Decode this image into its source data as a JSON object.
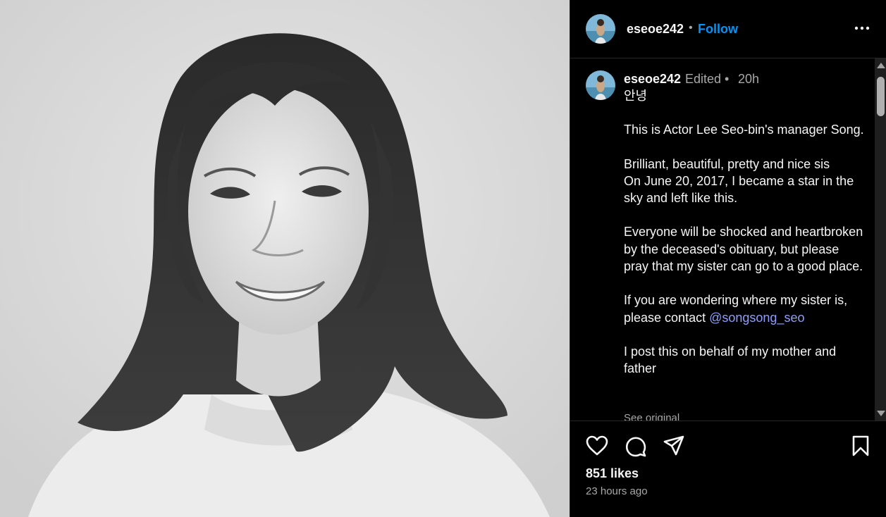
{
  "post": {
    "username": "eseoe242",
    "follow_label": "Follow",
    "separator": "•",
    "more_label": "More options"
  },
  "caption": {
    "username": "eseoe242",
    "edited": "Edited •",
    "time": "20h",
    "lines": {
      "l1": "안녕",
      "l2": "This is Actor Lee Seo-bin's manager Song.",
      "l3": "Brilliant, beautiful, pretty and nice sis",
      "l4": "On June 20, 2017, I became a star in the sky and left like this.",
      "l5": "Everyone will be shocked and heartbroken by the deceased's obituary, but please pray that my sister can go to a good place.",
      "l6": "If you are wondering where my sister is, please contact",
      "mention": "@songsong_seo",
      "l7": "I post this on behalf of my mother and father"
    },
    "see_original": "See original"
  },
  "engagement": {
    "likes": "851 likes",
    "posted_ago": "23 hours ago"
  },
  "icons": {
    "like": "heart-icon",
    "comment": "comment-bubble-icon",
    "share": "paper-plane-icon",
    "save": "bookmark-icon",
    "more": "ellipsis-icon"
  },
  "colors": {
    "background": "#000000",
    "text": "#f5f5f5",
    "muted": "#a8a8a8",
    "follow": "#0095f6",
    "mention": "#8e9fff"
  }
}
